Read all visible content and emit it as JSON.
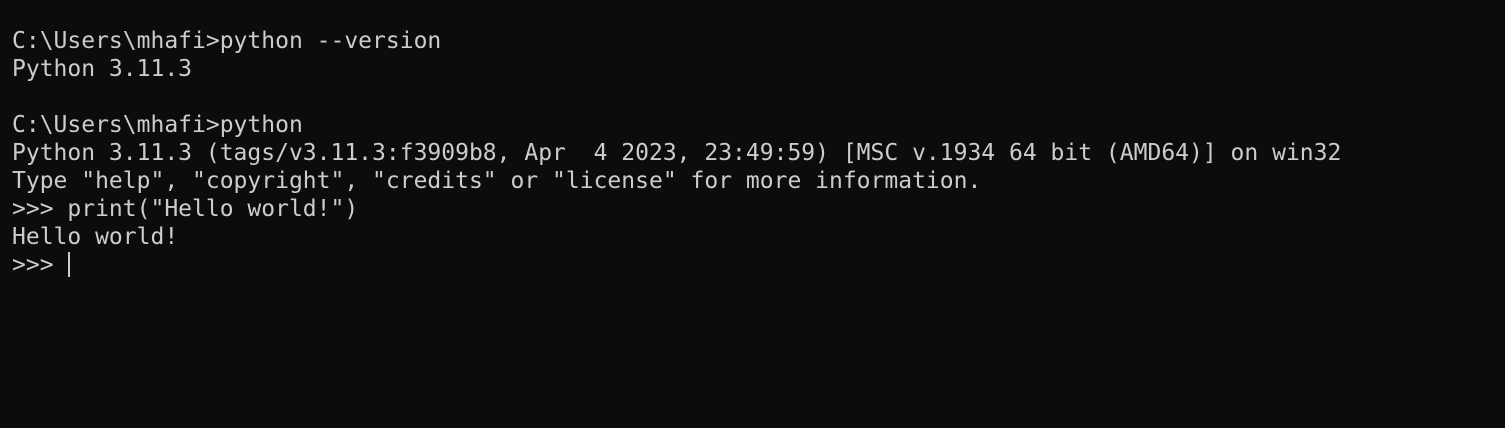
{
  "terminal": {
    "lines": [
      "C:\\Users\\mhafi>python --version",
      "Python 3.11.3",
      "",
      "C:\\Users\\mhafi>python",
      "Python 3.11.3 (tags/v3.11.3:f3909b8, Apr  4 2023, 23:49:59) [MSC v.1934 64 bit (AMD64)] on win32",
      "Type \"help\", \"copyright\", \"credits\" or \"license\" for more information.",
      ">>> print(\"Hello world!\")",
      "Hello world!"
    ],
    "prompt": ">>> "
  }
}
